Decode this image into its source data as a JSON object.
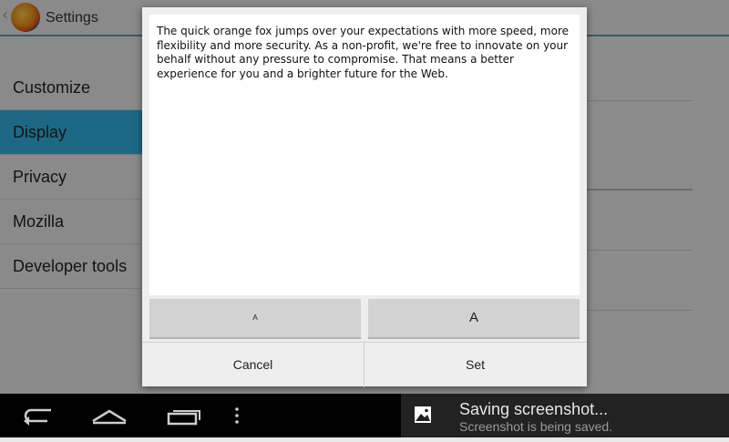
{
  "app": {
    "title": "Settings",
    "accent_color": "#33b5e5",
    "icon": "firefox-logo"
  },
  "sidebar": {
    "items": [
      {
        "label": "Customize",
        "selected": false
      },
      {
        "label": "Display",
        "selected": true
      },
      {
        "label": "Privacy",
        "selected": false
      },
      {
        "label": "Mozilla",
        "selected": false
      },
      {
        "label": "Developer tools",
        "selected": false
      }
    ]
  },
  "dialog": {
    "preview_text": "The quick orange fox jumps over your expectations with more speed, more flexibility and more security. As a non-profit, we're free to innovate on your behalf without any pressure to compromise. That means a better experience for you and a brighter future for the Web.",
    "smaller_label": "A",
    "larger_label": "A",
    "cancel_label": "Cancel",
    "set_label": "Set"
  },
  "system_bar": {
    "icons": [
      "back-icon",
      "home-icon",
      "recent-apps-icon",
      "menu-icon"
    ],
    "notification": {
      "icon": "image-icon",
      "title": "Saving screenshot...",
      "subtitle": "Screenshot is being saved."
    }
  }
}
